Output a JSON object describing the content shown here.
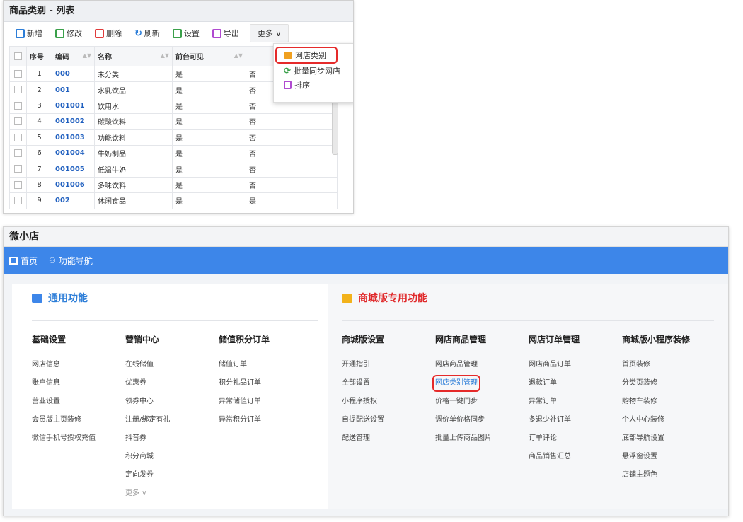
{
  "list_panel": {
    "title": "商品类别 - 列表",
    "toolbar": {
      "add": "新增",
      "edit": "修改",
      "delete": "删除",
      "refresh": "刷新",
      "settings": "设置",
      "export": "导出",
      "more": "更多 ∨"
    },
    "columns": [
      "序号",
      "编码",
      "名称",
      "前台可见",
      ""
    ],
    "rows": [
      {
        "no": "1",
        "code": "000",
        "name": "未分类",
        "visible": "是",
        "extra": "否"
      },
      {
        "no": "2",
        "code": "001",
        "name": "水乳饮品",
        "visible": "是",
        "extra": "否"
      },
      {
        "no": "3",
        "code": "001001",
        "name": "饮用水",
        "visible": "是",
        "extra": "否"
      },
      {
        "no": "4",
        "code": "001002",
        "name": "碳酸饮料",
        "visible": "是",
        "extra": "否"
      },
      {
        "no": "5",
        "code": "001003",
        "name": "功能饮料",
        "visible": "是",
        "extra": "否"
      },
      {
        "no": "6",
        "code": "001004",
        "name": "牛奶制品",
        "visible": "是",
        "extra": "否"
      },
      {
        "no": "7",
        "code": "001005",
        "name": "低温牛奶",
        "visible": "是",
        "extra": "否"
      },
      {
        "no": "8",
        "code": "001006",
        "name": "多味饮料",
        "visible": "是",
        "extra": "否"
      },
      {
        "no": "9",
        "code": "002",
        "name": "休闲食品",
        "visible": "是",
        "extra": "是"
      }
    ],
    "dropdown": {
      "store_category": "网店类别",
      "batch_sync": "批量同步网店",
      "sort": "排序"
    }
  },
  "shop_panel": {
    "title": "微小店",
    "nav": {
      "home": "首页",
      "function_nav": "功能导航"
    },
    "general_section": "通用功能",
    "mall_section": "商城版专用功能",
    "groups": [
      {
        "title": "基础设置",
        "items": [
          "网店信息",
          "账户信息",
          "营业设置",
          "会员版主页装修",
          "微信手机号授权充值"
        ]
      },
      {
        "title": "营销中心",
        "items": [
          "在线储值",
          "优惠券",
          "领券中心",
          "注册/绑定有礼",
          "抖音券",
          "积分商城",
          "定向发券",
          "更多 ∨"
        ]
      },
      {
        "title": "储值积分订单",
        "items": [
          "储值订单",
          "积分礼品订单",
          "异常储值订单",
          "异常积分订单"
        ]
      },
      {
        "title": "商城版设置",
        "items": [
          "开通指引",
          "全部设置",
          "小程序授权",
          "自提配送设置",
          "配送管理"
        ]
      },
      {
        "title": "网店商品管理",
        "items": [
          "网店商品管理",
          "网店类别管理",
          "价格一键同步",
          "调价单价格同步",
          "批量上传商品图片"
        ]
      },
      {
        "title": "网店订单管理",
        "items": [
          "网店商品订单",
          "退款订单",
          "异常订单",
          "多退少补订单",
          "订单评论",
          "商品销售汇总"
        ]
      },
      {
        "title": "商城版小程序装修",
        "items": [
          "首页装修",
          "分类页装修",
          "购物车装修",
          "个人中心装修",
          "底部导航设置",
          "悬浮窗设置",
          "店铺主题色"
        ]
      }
    ]
  }
}
